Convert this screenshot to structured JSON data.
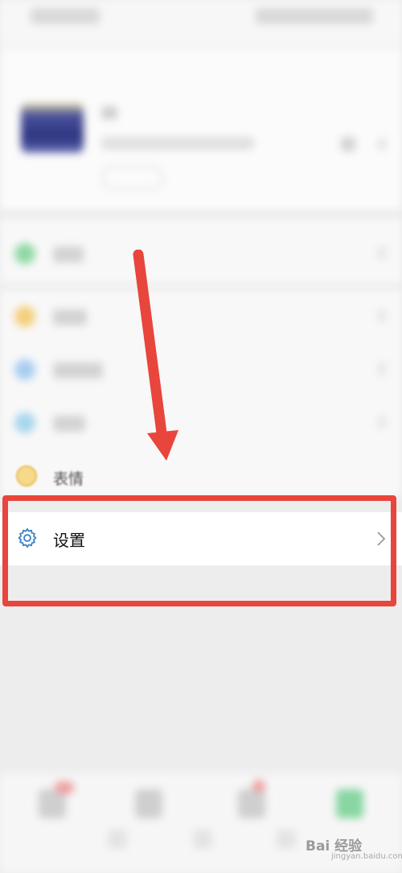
{
  "menu": {
    "sticker_label": "表情",
    "settings_label": "设置"
  },
  "annotation": {
    "arrow_color": "#e8453c",
    "box_color": "#e8453c"
  },
  "watermark": {
    "text": "Bai 经验",
    "sub": "jingyan.baidu.com"
  },
  "colors": {
    "accent_blue": "#3d85c6",
    "settings_bg": "#ffffff",
    "page_bg": "#ededed"
  },
  "icons": {
    "settings": "gear-icon",
    "sticker": "smiley-icon",
    "chevron": "chevron-right-icon"
  }
}
